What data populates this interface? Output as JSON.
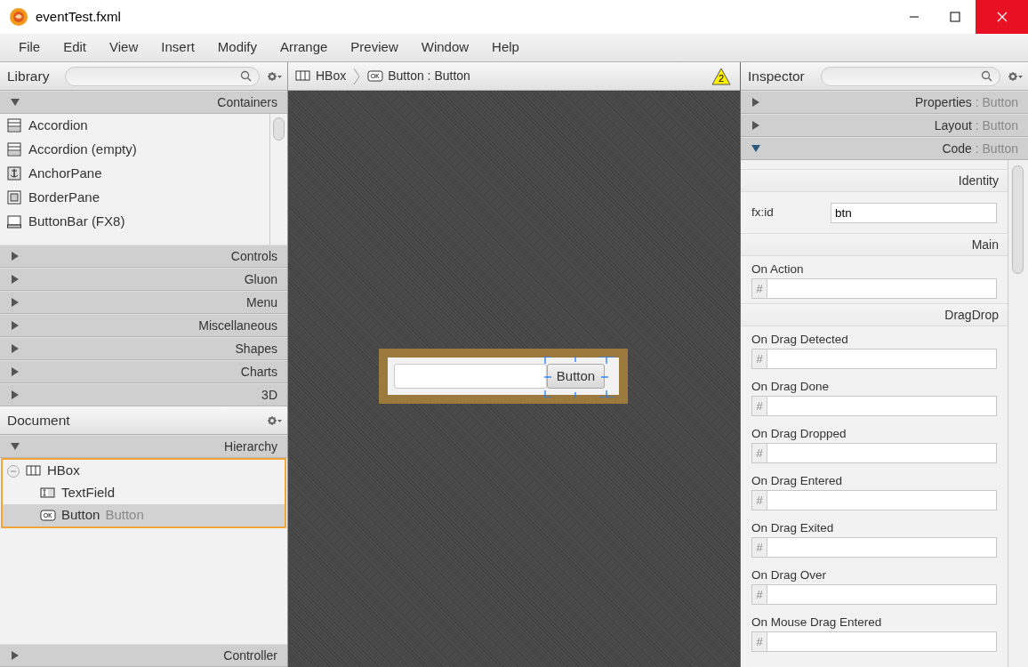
{
  "window": {
    "title": "eventTest.fxml"
  },
  "menu": [
    "File",
    "Edit",
    "View",
    "Insert",
    "Modify",
    "Arrange",
    "Preview",
    "Window",
    "Help"
  ],
  "library": {
    "title": "Library",
    "sections": [
      {
        "label": "Containers",
        "expanded": true,
        "items": [
          {
            "label": "Accordion",
            "kind": "accordion"
          },
          {
            "label": "Accordion  (empty)",
            "kind": "accordion"
          },
          {
            "label": "AnchorPane",
            "kind": "anchor"
          },
          {
            "label": "BorderPane",
            "kind": "border"
          },
          {
            "label": "ButtonBar  (FX8)",
            "kind": "buttonbar"
          }
        ]
      },
      {
        "label": "Controls",
        "expanded": false
      },
      {
        "label": "Gluon",
        "expanded": false
      },
      {
        "label": "Menu",
        "expanded": false
      },
      {
        "label": "Miscellaneous",
        "expanded": false
      },
      {
        "label": "Shapes",
        "expanded": false
      },
      {
        "label": "Charts",
        "expanded": false
      },
      {
        "label": "3D",
        "expanded": false
      }
    ]
  },
  "document": {
    "title": "Document",
    "section": {
      "label": "Hierarchy",
      "expanded": true
    },
    "tree": [
      {
        "label": "HBox",
        "kind": "hbox",
        "expanded": true,
        "selected": false,
        "children": [
          {
            "label": "TextField",
            "kind": "textfield",
            "selected": false
          },
          {
            "label": "Button",
            "detail": "Button",
            "kind": "button",
            "selected": true
          }
        ]
      }
    ],
    "controller": {
      "label": "Controller",
      "expanded": false
    }
  },
  "breadcrumb": [
    {
      "label": "HBox",
      "kind": "hbox"
    },
    {
      "label": "Button : Button",
      "kind": "button"
    }
  ],
  "warning_count": "2",
  "canvas": {
    "button": "Button"
  },
  "inspector": {
    "title": "Inspector",
    "sections": [
      {
        "label": "Properties",
        "detail": ": Button",
        "expanded": false
      },
      {
        "label": "Layout",
        "detail": ": Button",
        "expanded": false
      },
      {
        "label": "Code",
        "detail": ": Button",
        "expanded": true
      }
    ],
    "groups": [
      {
        "title": "Identity",
        "fields": [
          {
            "kind": "text",
            "label": "fx:id",
            "value": "btn"
          }
        ]
      },
      {
        "title": "Main",
        "fields": [
          {
            "kind": "handler",
            "label": "On Action",
            "prefix": "#"
          }
        ]
      },
      {
        "title": "DragDrop",
        "fields": [
          {
            "kind": "handler",
            "label": "On Drag Detected",
            "prefix": "#"
          },
          {
            "kind": "handler",
            "label": "On Drag Done",
            "prefix": "#"
          },
          {
            "kind": "handler",
            "label": "On Drag Dropped",
            "prefix": "#"
          },
          {
            "kind": "handler",
            "label": "On Drag Entered",
            "prefix": "#"
          },
          {
            "kind": "handler",
            "label": "On Drag Exited",
            "prefix": "#"
          },
          {
            "kind": "handler",
            "label": "On Drag Over",
            "prefix": "#"
          },
          {
            "kind": "handler",
            "label": "On Mouse Drag Entered",
            "prefix": "#"
          }
        ]
      }
    ]
  }
}
